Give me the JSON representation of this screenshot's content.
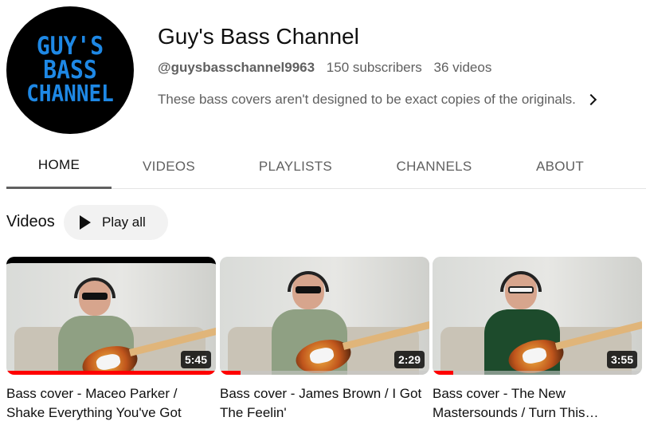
{
  "channel": {
    "avatar_text": [
      "GUY'S",
      "BASS",
      "CHANNEL"
    ],
    "name": "Guy's Bass Channel",
    "handle": "@guysbasschannel9963",
    "subscribers": "150 subscribers",
    "video_count": "36 videos",
    "description": "These bass covers aren't designed to be exact copies of the originals.",
    "description_icon": "chevron-right-icon"
  },
  "tabs": [
    {
      "label": "HOME",
      "active": true
    },
    {
      "label": "VIDEOS",
      "active": false
    },
    {
      "label": "PLAYLISTS",
      "active": false
    },
    {
      "label": "CHANNELS",
      "active": false
    },
    {
      "label": "ABOUT",
      "active": false
    }
  ],
  "videos_section": {
    "title": "Videos",
    "play_all_label": "Play all",
    "play_icon": "play-icon"
  },
  "videos": [
    {
      "title": "Bass cover - Maceo Parker / Shake Everything You've Got",
      "duration": "5:45",
      "progress": 1.0
    },
    {
      "title": "Bass cover - James Brown / I Got The Feelin'",
      "duration": "2:29",
      "progress": 0.1
    },
    {
      "title": "Bass cover - The New Mastersounds / Turn This…",
      "duration": "3:55",
      "progress": 0.1
    }
  ],
  "colors": {
    "avatar_bg": "#000000",
    "avatar_text": "#1e88e5",
    "progress": "#ff0000",
    "play_all_bg": "#f2f2f2"
  }
}
